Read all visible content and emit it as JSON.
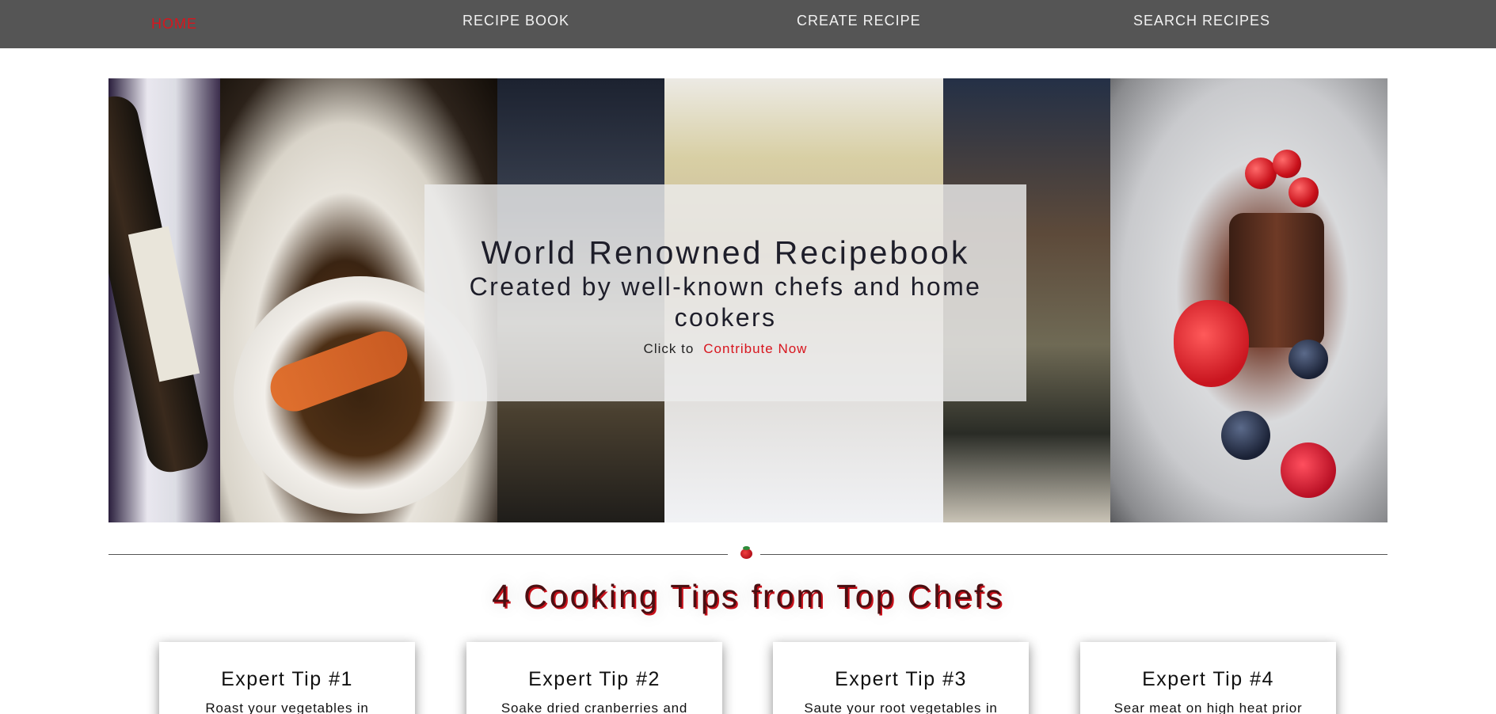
{
  "nav": {
    "items": [
      {
        "label": "HOME",
        "active": true
      },
      {
        "label": "RECIPE BOOK",
        "active": false
      },
      {
        "label": "CREATE RECIPE",
        "active": false
      },
      {
        "label": "SEARCH RECIPES",
        "active": false
      }
    ]
  },
  "hero": {
    "title": "World Renowned Recipebook",
    "subtitle": "Created by well-known chefs and home cookers",
    "cta_prefix": "Click to",
    "cta_link": "Contribute Now"
  },
  "tips": {
    "heading": "4 Cooking Tips from Top Chefs",
    "cards": [
      {
        "title": "Expert Tip #1",
        "text": "Roast your vegetables in"
      },
      {
        "title": "Expert Tip #2",
        "text": "Soake dried cranberries and"
      },
      {
        "title": "Expert Tip #3",
        "text": "Saute your root vegetables in"
      },
      {
        "title": "Expert Tip #4",
        "text": "Sear meat on high heat prior"
      }
    ]
  },
  "colors": {
    "nav_bg": "#555555",
    "accent_red": "#d8151d"
  }
}
